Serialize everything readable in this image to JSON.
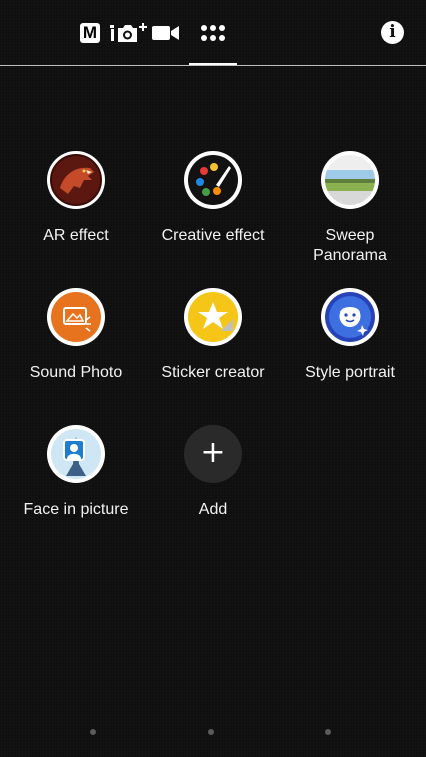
{
  "topbar": {
    "manual_mode_label": "M",
    "icons": [
      "manual-mode-icon",
      "photo-mode-icon",
      "video-mode-icon",
      "grid-apps-icon",
      "info-icon"
    ],
    "info_label": "i"
  },
  "apps": [
    {
      "label": "AR effect",
      "icon": "ar-effect-icon"
    },
    {
      "label": "Creative effect",
      "icon": "creative-effect-icon"
    },
    {
      "label": "Sweep\nPanorama",
      "icon": "sweep-panorama-icon"
    },
    {
      "label": "Sound Photo",
      "icon": "sound-photo-icon"
    },
    {
      "label": "Sticker creator",
      "icon": "sticker-creator-icon"
    },
    {
      "label": "Style portrait",
      "icon": "style-portrait-icon"
    },
    {
      "label": "Face in picture",
      "icon": "face-in-picture-icon"
    },
    {
      "label": "Add",
      "icon": "add-icon"
    }
  ],
  "add_symbol": "+",
  "pager": {
    "pages": 3
  }
}
